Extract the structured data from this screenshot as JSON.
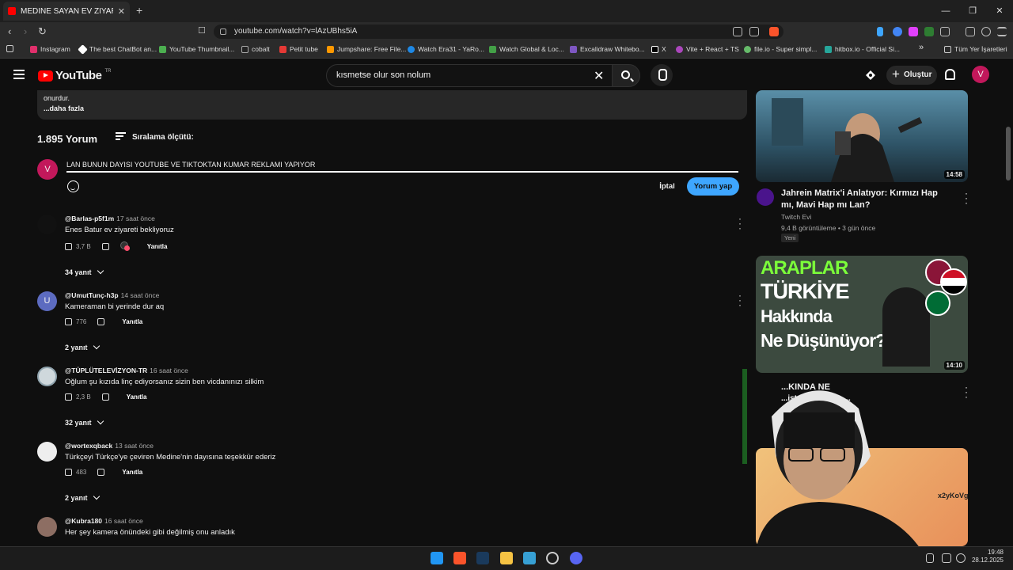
{
  "browser": {
    "tab_title": "MEDİNE SAYAN EV ZİYARETİ - Yo",
    "tab_close": "✕",
    "new_tab": "+",
    "url": "youtube.com/watch?v=lAzUBhs5iA",
    "window_controls": [
      "—",
      "❐",
      "✕"
    ],
    "bookmarks": [
      {
        "label": "Instagram",
        "color": "#e1306c"
      },
      {
        "label": "The best ChatBot an...",
        "color": "#ffffff"
      },
      {
        "label": "YouTube Thumbnail...",
        "color": "#4caf50"
      },
      {
        "label": "cobalt",
        "color": "#ffffff"
      },
      {
        "label": "Petit tube",
        "color": "#e53935"
      },
      {
        "label": "Jumpshare: Free File...",
        "color": "#ff9800"
      },
      {
        "label": "Watch Era31 - YaRo...",
        "color": "#1e88e5"
      },
      {
        "label": "Watch Global & Loc...",
        "color": "#43a047"
      },
      {
        "label": "Excalidraw Whitebo...",
        "color": "#7e57c2"
      },
      {
        "label": "X",
        "color": "#ffffff"
      },
      {
        "label": "Vite + React + TS",
        "color": "#ab47bc"
      },
      {
        "label": "file.io - Super simpl...",
        "color": "#66bb6a"
      },
      {
        "label": "hitbox.io - Official Si...",
        "color": "#26a69a"
      }
    ],
    "more_bookmarks": "»",
    "all_bookmarks": "Tüm Yer İşaretleri"
  },
  "header": {
    "logo_text": "YouTube",
    "logo_region": "TR",
    "search_value": "kısmetse olur son nolum",
    "clear_icon": "✕",
    "create_label": "Oluştur",
    "avatar_letter": "V"
  },
  "description": {
    "line1": "onurdur.",
    "more": "...daha fazla"
  },
  "comments": {
    "count": "1.895 Yorum",
    "sort_label": "Sıralama ölçütü:",
    "my_avatar": "V",
    "draft": "LAN BUNUN DAYISI YOUTUBE VE TIKTOKTAN KUMAR REKLAMI YAPIYOR",
    "cancel": "İptal",
    "submit": "Yorum yap",
    "reply_label": "Yanıtla",
    "items": [
      {
        "author": "@Barlas-p5f1m",
        "time": "17 saat önce",
        "text": "Enes Batur ev ziyareti bekliyoruz",
        "likes": "3,7 B",
        "replies": "34 yanıt",
        "avatar_color": "#111111",
        "avatar_letter": ""
      },
      {
        "author": "@UmutTunç-h3p",
        "time": "14 saat önce",
        "text": "Kameraman bi yerinde dur aq",
        "likes": "776",
        "replies": "2 yanıt",
        "avatar_color": "#5c6bc0",
        "avatar_letter": "U"
      },
      {
        "author": "@TÜPLÜTELEVİZYON-TR",
        "time": "16 saat önce",
        "text": "Oğlum şu kızıda linç ediyorsanız sizin ben vicdanınızı silkim",
        "likes": "2,3 B",
        "replies": "32 yanıt",
        "avatar_color": "#cfd8dc",
        "avatar_letter": ""
      },
      {
        "author": "@wortexqback",
        "time": "13 saat önce",
        "text": "Türkçeyi Türkçe'ye çeviren Medine'nin dayısına teşekkür ederiz",
        "likes": "483",
        "replies": "2 yanıt",
        "avatar_color": "#eeeeee",
        "avatar_letter": ""
      },
      {
        "author": "@Kubra180",
        "time": "16 saat önce",
        "text": "Her şey kamera önündeki gibi değilmiş onu anladık",
        "likes": "",
        "replies": "",
        "avatar_color": "#8d6e63",
        "avatar_letter": ""
      }
    ]
  },
  "sidebar": {
    "videos": [
      {
        "title": "Jahrein Matrix'i Anlatıyor: Kırmızı Hap mı, Mavi Hap mı Lan?",
        "channel": "Twitch Evi",
        "meta": "9,4 B görüntüleme • 3 gün önce",
        "badge": "Yeni",
        "duration": "14:58"
      },
      {
        "title": "...KINDA NE",
        "channel": "",
        "meta": "...istan, Katar ve ...",
        "badge": "",
        "duration": "14:10",
        "thumb_line1": "ARAPLAR",
        "thumb_line2": "TÜRKİYE",
        "thumb_line3": "Hakkında",
        "thumb_line4": "Ne Düşünüyor?"
      }
    ],
    "third_tag": "x2yKoVg"
  },
  "taskbar": {
    "time": "19:48",
    "date": "28.12.2025"
  }
}
